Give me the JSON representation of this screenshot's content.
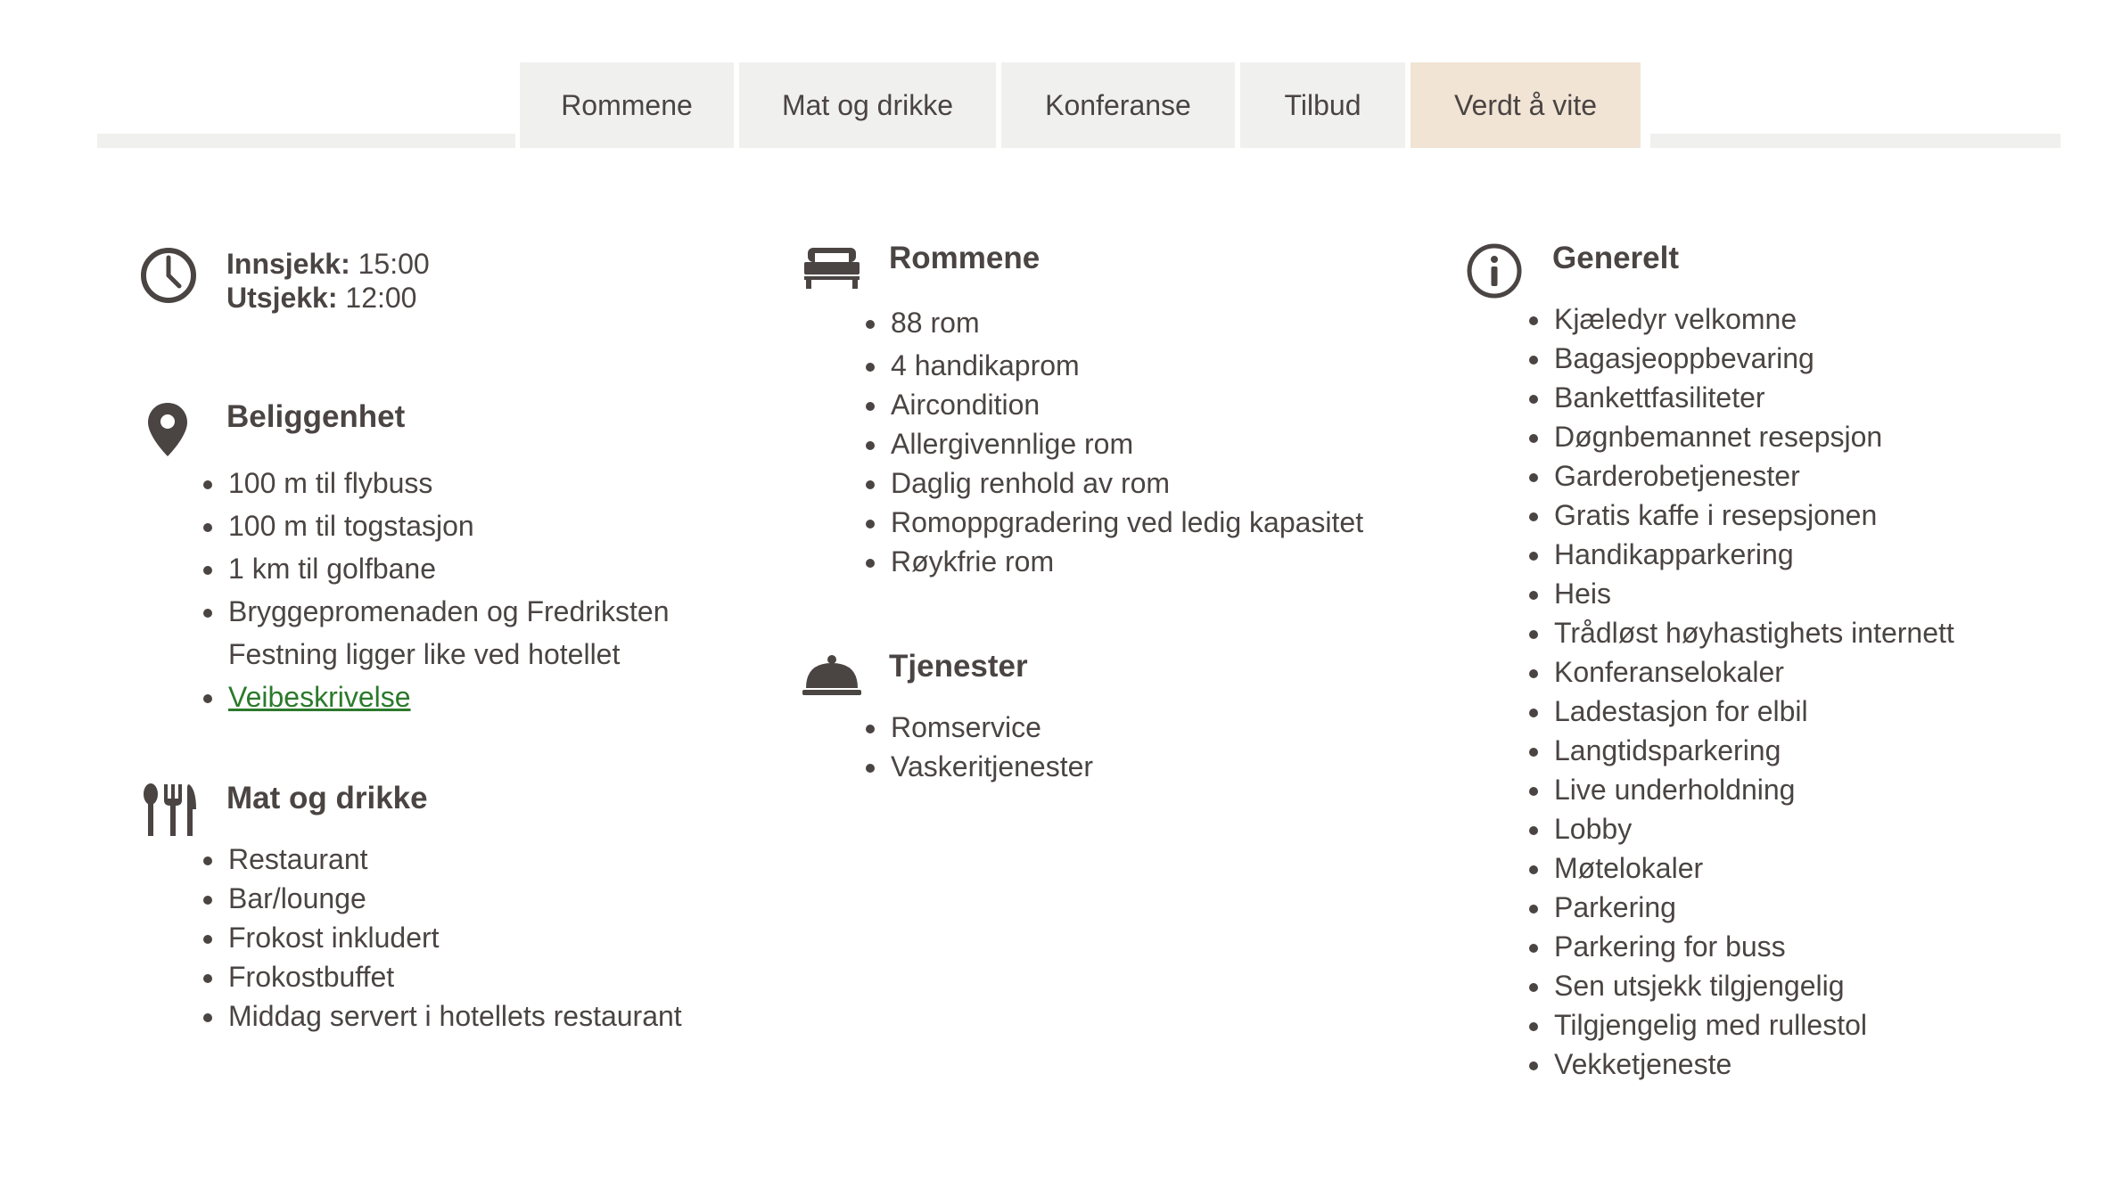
{
  "tabs": [
    {
      "label": "Rommene",
      "active": false
    },
    {
      "label": "Mat og drikke",
      "active": false
    },
    {
      "label": "Konferanse",
      "active": false
    },
    {
      "label": "Tilbud",
      "active": false
    },
    {
      "label": "Verdt å vite",
      "active": true
    }
  ],
  "checkin": {
    "in_label": "Innsjekk:",
    "in_time": "15:00",
    "out_label": "Utsjekk:",
    "out_time": "12:00",
    "icon": "clock-icon"
  },
  "location": {
    "title": "Beliggenhet",
    "icon": "map-pin-icon",
    "items": [
      "100 m til flybuss",
      "100 m til togstasjon",
      "1 km til golfbane",
      "Bryggepromenaden og Fredriksten Festning ligger like ved hotellet"
    ],
    "link_label": "Veibeskrivelse"
  },
  "food": {
    "title": "Mat og drikke",
    "icon": "cutlery-icon",
    "items": [
      "Restaurant",
      "Bar/lounge",
      "Frokost inkludert",
      "Frokostbuffet",
      "Middag servert i hotellets restaurant"
    ]
  },
  "rooms": {
    "title": "Rommene",
    "icon": "bed-icon",
    "items": [
      "88 rom",
      "4 handikaprom",
      "Aircondition",
      "Allergivennlige rom",
      "Daglig renhold av rom",
      "Romoppgradering ved ledig kapasitet",
      "Røykfrie rom"
    ]
  },
  "services": {
    "title": "Tjenester",
    "icon": "room-service-icon",
    "items": [
      "Romservice",
      "Vaskeritjenester"
    ]
  },
  "general": {
    "title": "Generelt",
    "icon": "info-icon",
    "items": [
      "Kjæledyr velkomne",
      "Bagasjeoppbevaring",
      "Bankettfasiliteter",
      "Døgnbemannet resepsjon",
      "Garderobetjenester",
      "Gratis kaffe i resepsjonen",
      "Handikapparkering",
      "Heis",
      "Trådløst høyhastighets internett",
      "Konferanselokaler",
      "Ladestasjon for elbil",
      "Langtidsparkering",
      "Live underholdning",
      "Lobby",
      "Møtelokaler",
      "Parkering",
      "Parkering for buss",
      "Sen utsjekk tilgjengelig",
      "Tilgjengelig med rullestol",
      "Vekketjeneste"
    ]
  },
  "colors": {
    "text": "#4a4443",
    "tab_bg": "#f0f0ef",
    "tab_active_bg": "#f1e4d4",
    "link": "#2b7a2b"
  }
}
